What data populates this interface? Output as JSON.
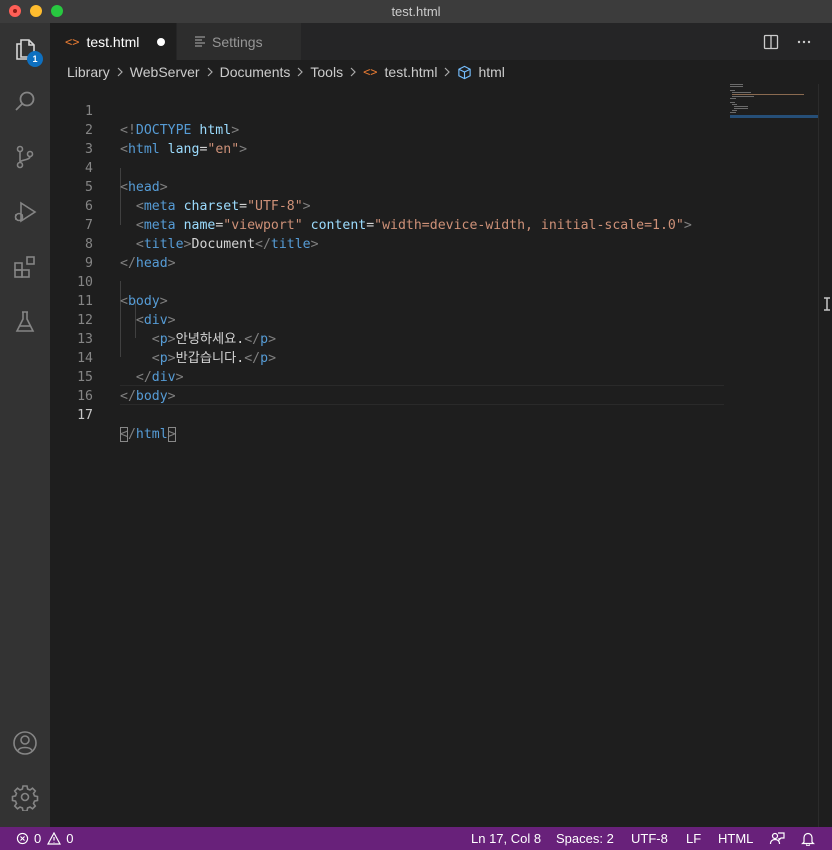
{
  "window": {
    "title": "test.html"
  },
  "activity_bar": {
    "explorer_badge": "1"
  },
  "tabs": [
    {
      "label": "test.html",
      "active": true,
      "modified": true,
      "icon": "code-icon"
    },
    {
      "label": "Settings",
      "active": false,
      "icon": "settings-list-icon"
    }
  ],
  "breadcrumb": [
    "Library",
    "WebServer",
    "Documents",
    "Tools",
    "test.html",
    "html"
  ],
  "editor": {
    "line_numbers": [
      "1",
      "2",
      "3",
      "4",
      "5",
      "6",
      "7",
      "8",
      "9",
      "10",
      "11",
      "12",
      "13",
      "14",
      "15",
      "16",
      "17"
    ],
    "lines": [
      "<!DOCTYPE html>",
      "<html lang=\"en\">",
      "",
      "<head>",
      "  <meta charset=\"UTF-8\">",
      "  <meta name=\"viewport\" content=\"width=device-width, initial-scale=1.0\">",
      "  <title>Document</title>",
      "</head>",
      "",
      "<body>",
      "  <div>",
      "    <p>안녕하세요.</p>",
      "    <p>반갑습니다.</p>",
      "  </div>",
      "</body>",
      "",
      "</html>"
    ],
    "cursor_line": 17
  },
  "status_bar": {
    "errors": "0",
    "warnings": "0",
    "position": "Ln 17, Col 8",
    "spaces": "Spaces: 2",
    "encoding": "UTF-8",
    "eol": "LF",
    "language": "HTML"
  },
  "colors": {
    "status_bar": "#68217a",
    "activity_bar": "#333333",
    "editor_bg": "#1e1e1e",
    "tag": "#569cd6",
    "attribute": "#9cdcfe",
    "string": "#ce9178",
    "badge": "#0e70c0"
  }
}
